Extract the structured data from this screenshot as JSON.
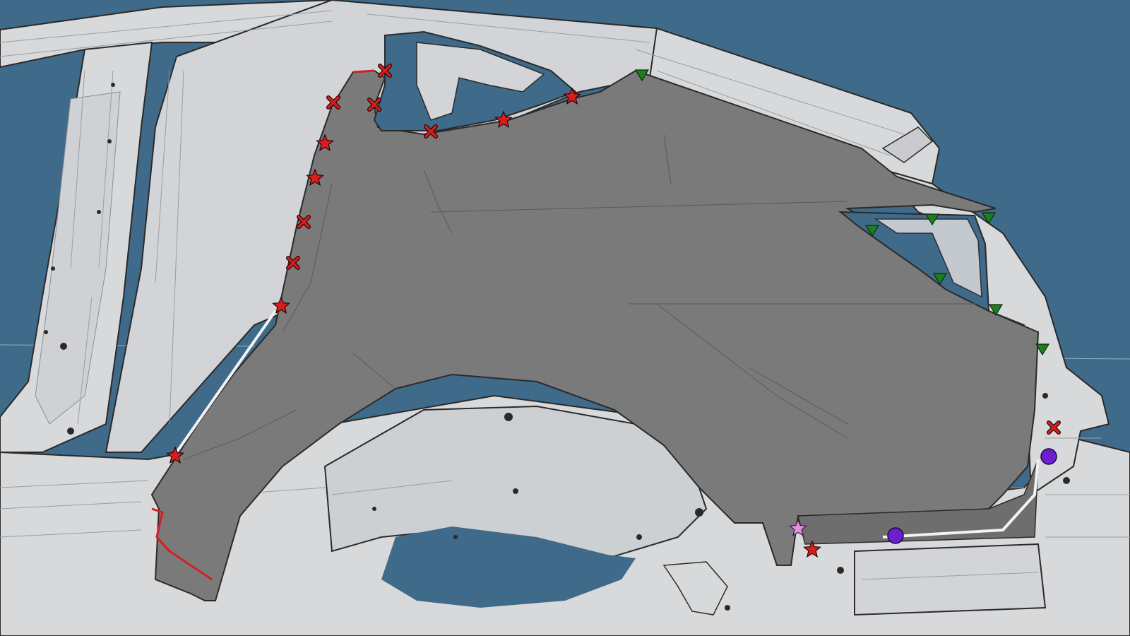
{
  "viewport": {
    "background": "#3f6a8a",
    "guide_color": "#8fb3cc"
  },
  "colors": {
    "body_panel": "#d7d9db",
    "body_panel_alt": "#c9cbce",
    "body_edge": "#2a2a2a",
    "wireframe_line": "#9a9ea3",
    "quarter_panel": "#7a7a7a",
    "quarter_panel_shade": "#6e6e6e",
    "red_edge": "#d51f1f"
  },
  "markers": {
    "weld_spot_cross": {
      "icon": "red-x-icon",
      "color": "#d51f1f"
    },
    "weld_star": {
      "icon": "red-star-icon",
      "color": "#d51f1f"
    },
    "clip_triangle": {
      "icon": "green-triangle-icon",
      "color": "#1e7d1e"
    },
    "locator_pin": {
      "icon": "purple-circle-icon",
      "color": "#6a1fd0"
    },
    "pink_star": {
      "icon": "pink-star-icon",
      "color": "#e28fdc"
    }
  }
}
